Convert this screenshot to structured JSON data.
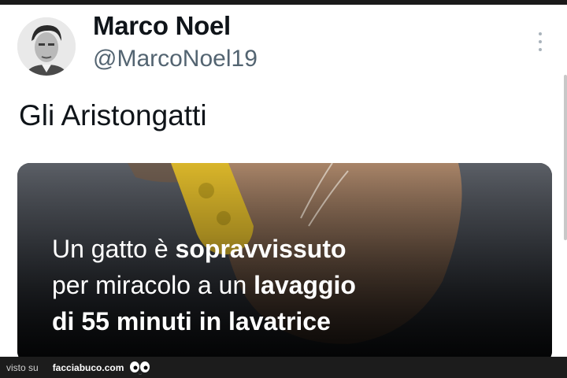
{
  "tweet": {
    "display_name": "Marco Noel",
    "handle": "@MarcoNoel19",
    "text": "Gli Aristongatti",
    "more_icon": "more-vertical-icon"
  },
  "media": {
    "headline_line1_a": "Un gatto ",
    "headline_line1_b": "è ",
    "headline_line1_c": "sopravvissuto",
    "headline_line2_a": "per miracolo a un ",
    "headline_line2_b": "lavaggio",
    "headline_line3": "di 55 minuti in lavatrice"
  },
  "footer": {
    "seen_on": "visto su",
    "site": "facciabuco.com",
    "logo_icon": "eyes-logo-icon"
  }
}
